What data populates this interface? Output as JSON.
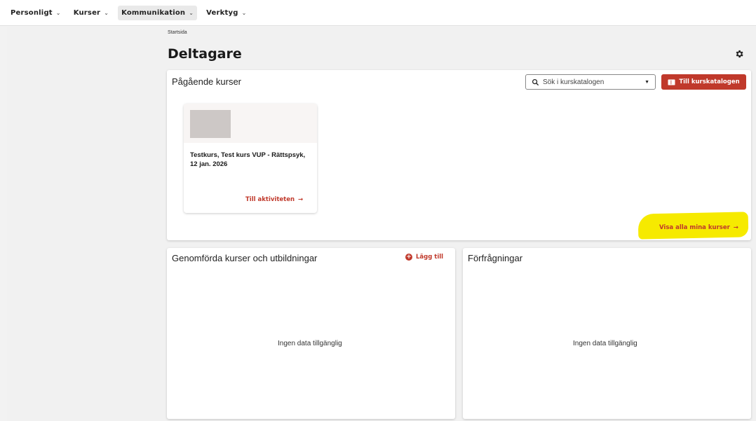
{
  "nav": {
    "items": [
      {
        "label": "Personligt"
      },
      {
        "label": "Kurser"
      },
      {
        "label": "Kommunikation"
      },
      {
        "label": "Verktyg"
      }
    ]
  },
  "breadcrumb": "Startsida",
  "page_title": "Deltagare",
  "ongoing": {
    "title": "Pågående kurser",
    "search_placeholder": "Sök i kurskatalogen",
    "catalog_button": "Till kurskatalogen",
    "course": {
      "title": "Testkurs, Test kurs VUP - Rättspsyk, 12 jan. 2026",
      "link": "Till aktiviteten"
    },
    "view_all": "Visa alla mina kurser"
  },
  "completed": {
    "title": "Genomförda kurser och utbildningar",
    "add_label": "Lägg till",
    "empty": "Ingen data tillgänglig"
  },
  "requests": {
    "title": "Förfrågningar",
    "empty": "Ingen data tillgänglig"
  },
  "colors": {
    "accent": "#c0392b",
    "highlight": "#f6ea00"
  }
}
